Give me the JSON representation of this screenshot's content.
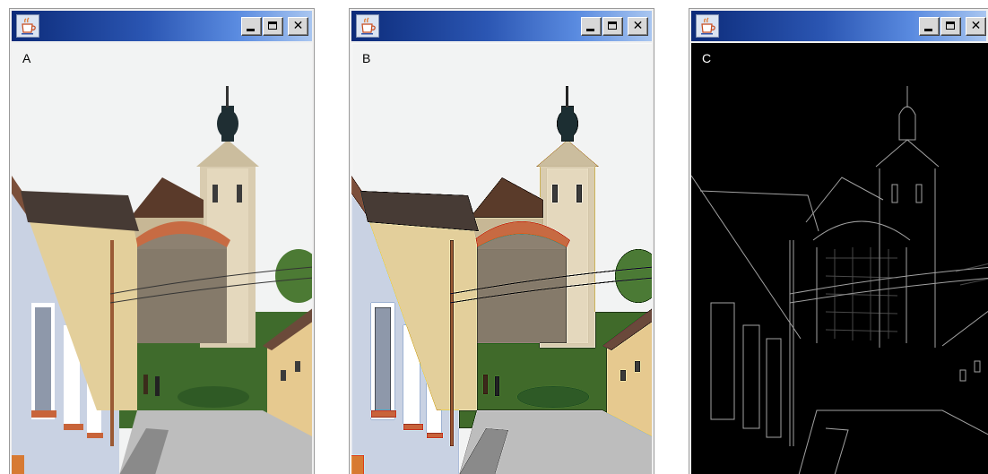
{
  "windows": [
    {
      "label": "A",
      "filter": "original",
      "minimize_icon": "minimize-icon",
      "maximize_icon": "maximize-icon",
      "close_icon": "close-icon",
      "app_icon": "java-coffee-cup-icon"
    },
    {
      "label": "B",
      "filter": "sharpened",
      "minimize_icon": "minimize-icon",
      "maximize_icon": "maximize-icon",
      "close_icon": "close-icon",
      "app_icon": "java-coffee-cup-icon"
    },
    {
      "label": "C",
      "filter": "edge-detected",
      "minimize_icon": "minimize-icon",
      "maximize_icon": "maximize-icon",
      "close_icon": "close-icon",
      "app_icon": "java-coffee-cup-icon"
    }
  ],
  "buttons": {
    "close_glyph": "✕"
  },
  "colors": {
    "titlebar_dark": "#0c2b79",
    "titlebar_light": "#a9c6f0",
    "edge_background": "#000000"
  }
}
